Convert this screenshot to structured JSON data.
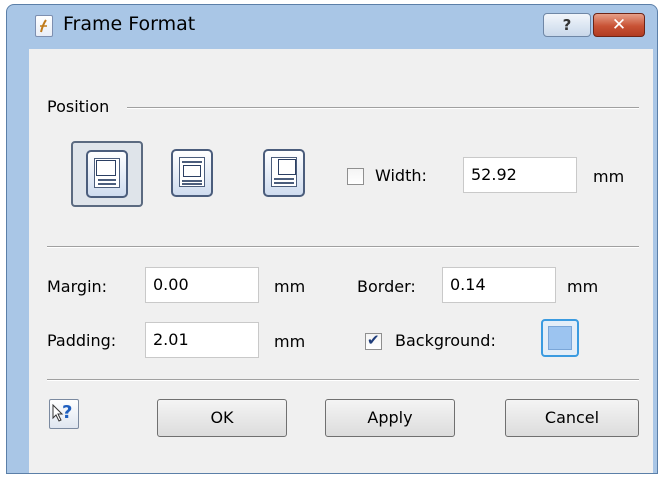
{
  "window": {
    "title": "Frame Format",
    "help_label": "?",
    "close_label": "✕"
  },
  "position": {
    "group_label": "Position",
    "buttons": [
      {
        "icon": "frame-left-icon",
        "selected": true
      },
      {
        "icon": "frame-center-icon",
        "selected": false
      },
      {
        "icon": "frame-right-icon",
        "selected": false
      }
    ],
    "width_checkbox_checked": false,
    "width_label": "Width:",
    "width_value": "52.92",
    "width_unit": "mm"
  },
  "spacing": {
    "margin_label": "Margin:",
    "margin_value": "0.00",
    "margin_unit": "mm",
    "border_label": "Border:",
    "border_value": "0.14",
    "border_unit": "mm",
    "padding_label": "Padding:",
    "padding_value": "2.01",
    "padding_unit": "mm",
    "background_checked": true,
    "background_label": "Background:",
    "background_color": "#9cc4f0"
  },
  "footer": {
    "ok_label": "OK",
    "apply_label": "Apply",
    "cancel_label": "Cancel",
    "help_icon": "context-help-icon"
  }
}
